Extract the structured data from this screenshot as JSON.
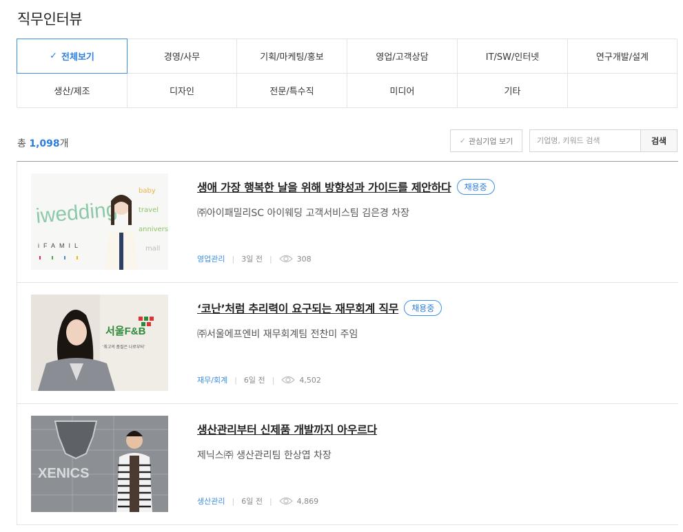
{
  "page_title": "직무인터뷰",
  "categories": [
    {
      "label": "전체보기",
      "active": true
    },
    {
      "label": "경영/사무"
    },
    {
      "label": "기획/마케팅/홍보"
    },
    {
      "label": "영업/고객상담"
    },
    {
      "label": "IT/SW/인터넷"
    },
    {
      "label": "연구개발/설계"
    },
    {
      "label": "생산/제조"
    },
    {
      "label": "디자인"
    },
    {
      "label": "전문/특수직"
    },
    {
      "label": "미디어"
    },
    {
      "label": "기타"
    },
    {
      "label": ""
    }
  ],
  "count": {
    "prefix": "총 ",
    "value": "1,098",
    "suffix": "개"
  },
  "toolbar": {
    "fav_label": "관심기업 보기",
    "search_placeholder": "기업명, 키워드 검색",
    "search_button": "검색"
  },
  "items": [
    {
      "title": "생애 가장 행복한 날을 위해 방향성과 가이드를 제안하다",
      "badge": "채용중",
      "subtitle": "㈜아이패밀리SC 아이웨딩 고객서비스팀 김은경 차장",
      "category": "영업관리",
      "date": "3일 전",
      "views": "308",
      "thumb_text": "iwedding",
      "thumb_sub": "iFAMIL",
      "thumb_side": [
        "baby",
        "travel",
        "anniversary",
        "mall"
      ]
    },
    {
      "title": "‘코난’처럼 추리력이 요구되는 재무회계 직무",
      "badge": "채용중",
      "subtitle": "㈜서울에프엔비 재무회계팀 전찬미 주임",
      "category": "재무/회계",
      "date": "6일 전",
      "views": "4,502",
      "thumb_text": "서울F&B",
      "thumb_sub": "‘최고의 품질은 나로부터’"
    },
    {
      "title": "생산관리부터 신제품 개발까지 아우르다",
      "badge": "",
      "subtitle": "제닉스㈜ 생산관리팀 한상엽 차장",
      "category": "생산관리",
      "date": "6일 전",
      "views": "4,869",
      "thumb_text": "XENICS"
    }
  ],
  "colors": {
    "accent": "#2b7de0"
  }
}
